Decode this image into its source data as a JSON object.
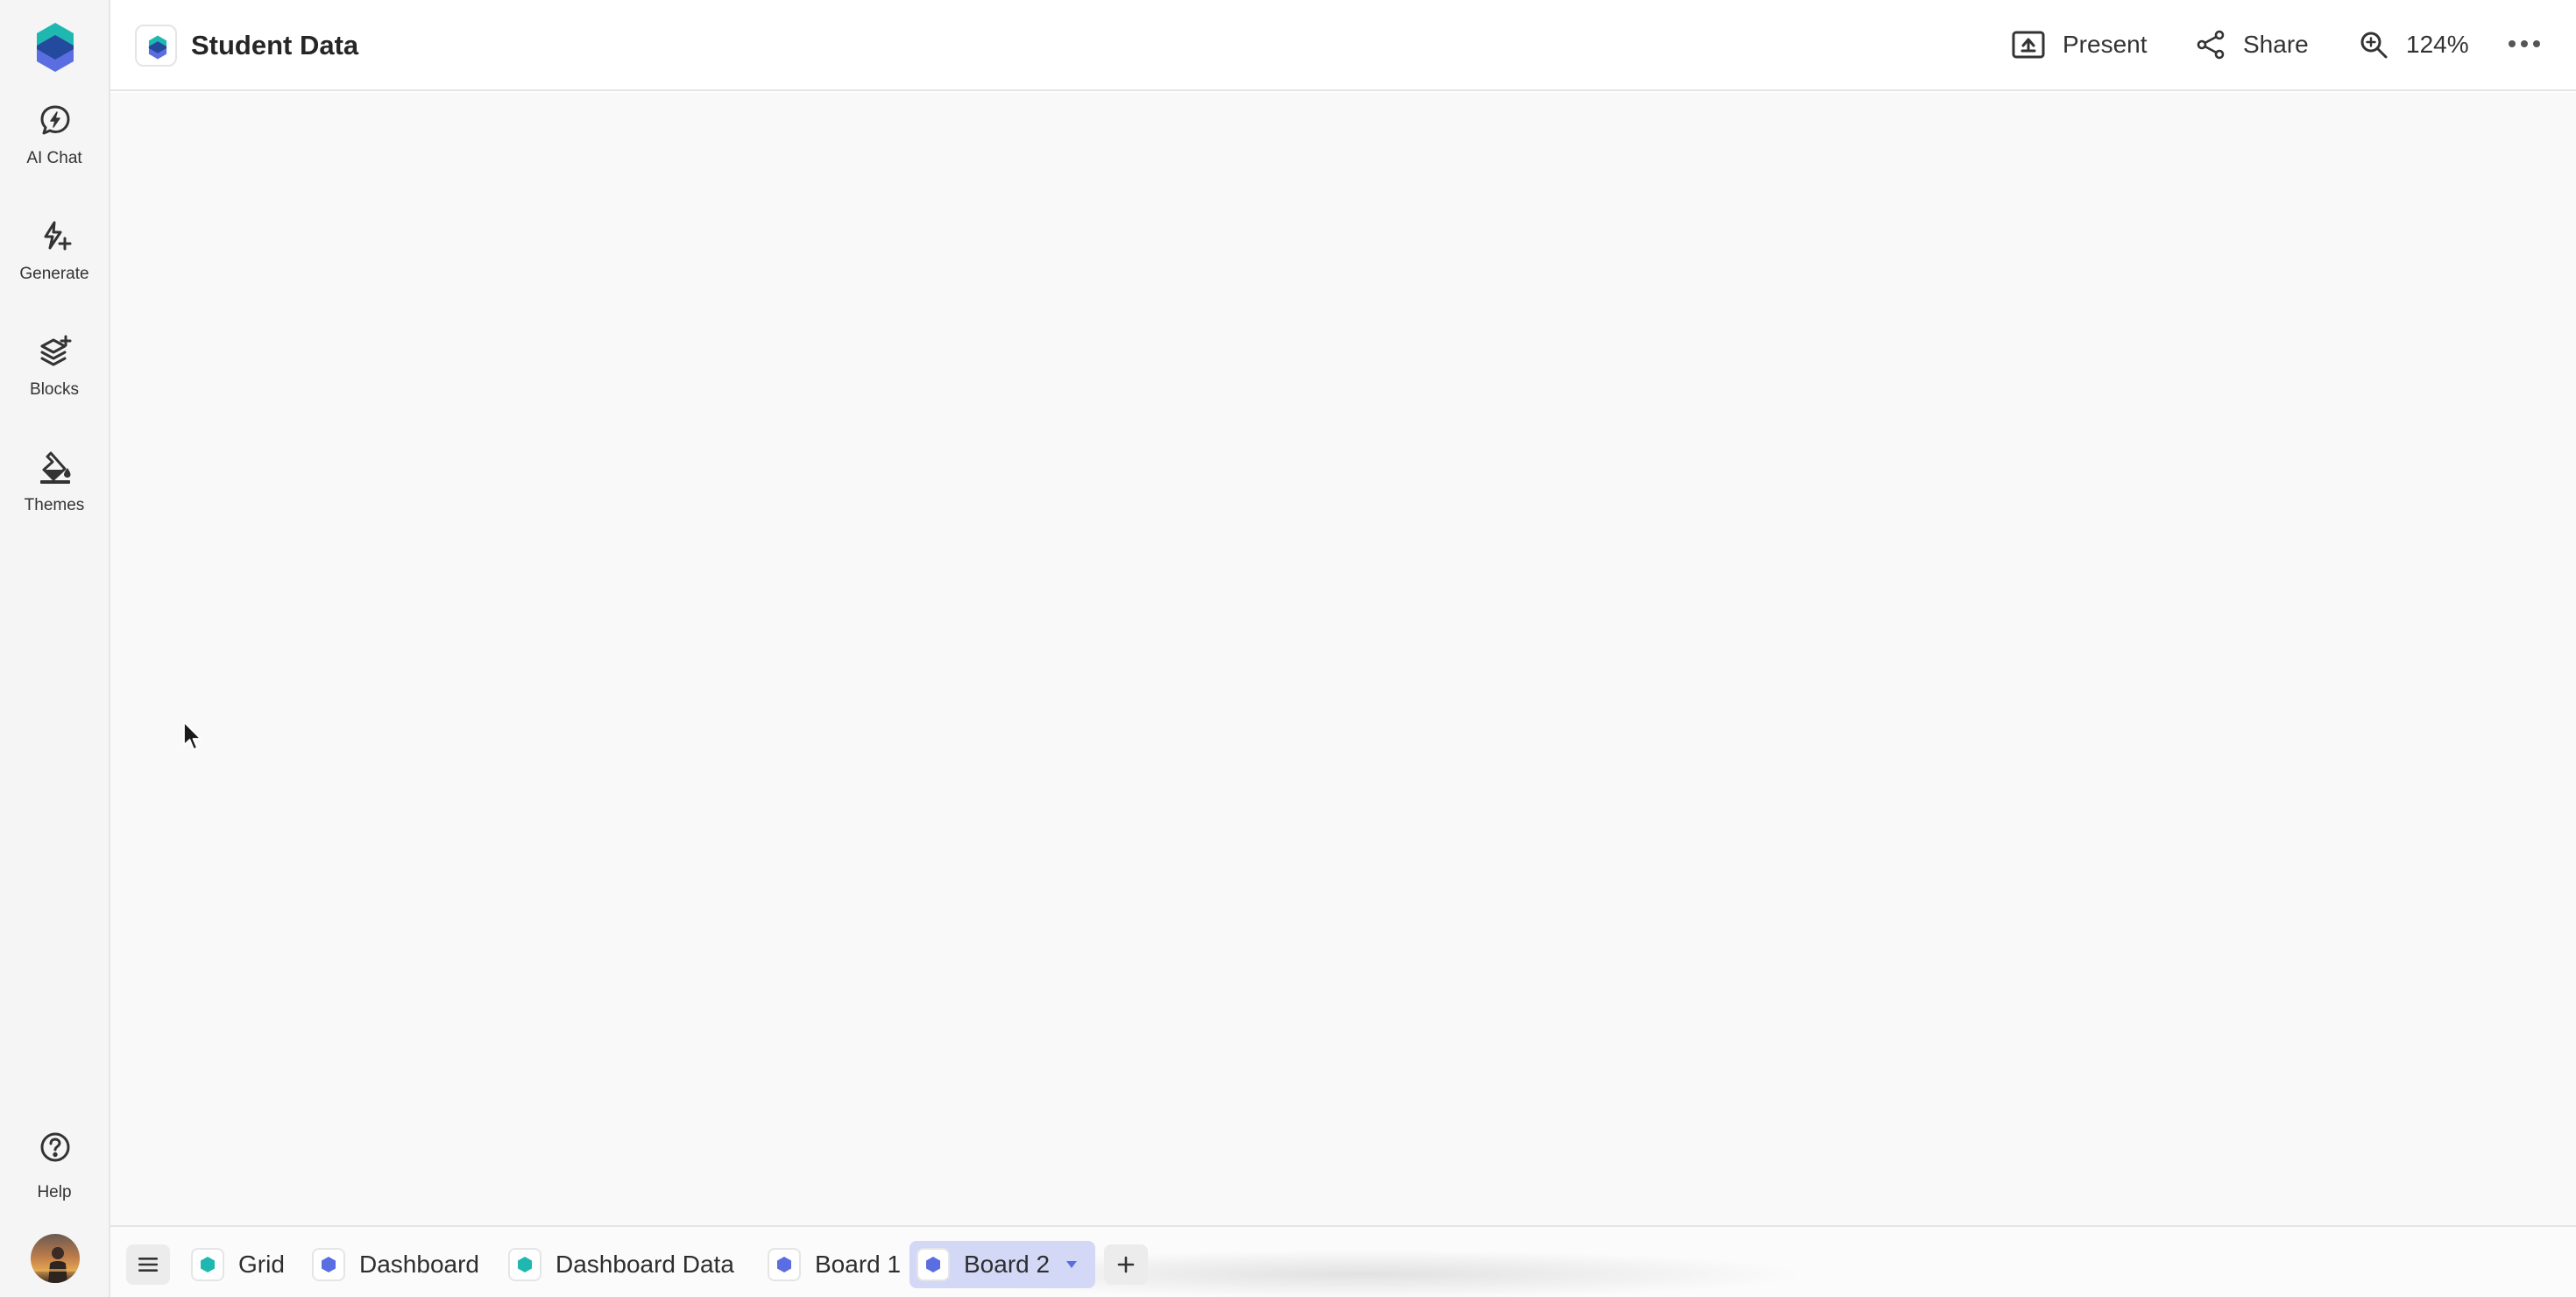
{
  "app": {
    "document_title": "Student Data",
    "logo_icon": "hexagon-logo-icon",
    "colors": {
      "teal": "#1fb8b0",
      "blue": "#5b6ee1",
      "active_tab_bg": "#d3d8f7"
    }
  },
  "sidebar": {
    "items": [
      {
        "label": "AI Chat",
        "icon": "ai-chat-icon"
      },
      {
        "label": "Generate",
        "icon": "generate-icon"
      },
      {
        "label": "Blocks",
        "icon": "blocks-icon"
      },
      {
        "label": "Themes",
        "icon": "themes-icon"
      }
    ],
    "help_label": "Help"
  },
  "header": {
    "present_label": "Present",
    "share_label": "Share",
    "zoom_label": "124%"
  },
  "tabs": [
    {
      "label": "Grid",
      "icon_color": "teal"
    },
    {
      "label": "Dashboard",
      "icon_color": "blue"
    },
    {
      "label": "Dashboard Data",
      "icon_color": "teal"
    },
    {
      "label": "Board 1",
      "icon_color": "blue"
    },
    {
      "label": "Board 2",
      "icon_color": "blue",
      "active": true
    }
  ]
}
